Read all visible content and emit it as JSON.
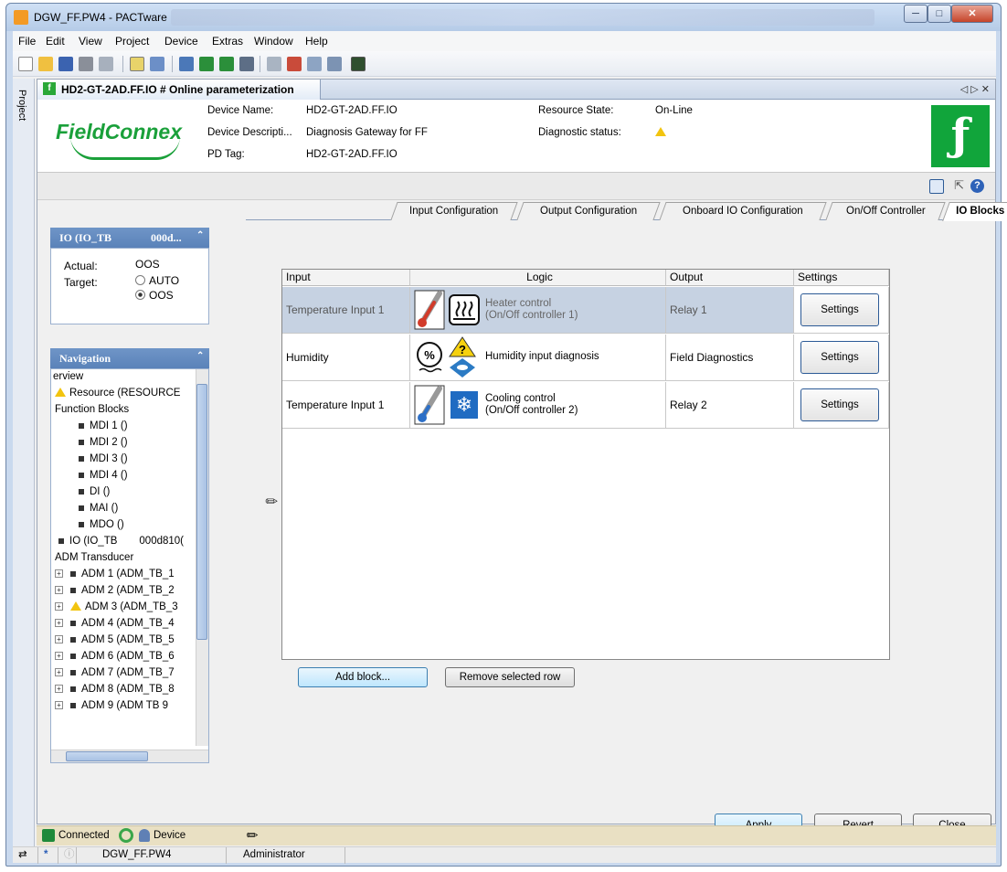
{
  "window": {
    "title": "DGW_FF.PW4 - PACTware"
  },
  "menu": [
    "File",
    "Edit",
    "View",
    "Project",
    "Device",
    "Extras",
    "Window",
    "Help"
  ],
  "project_tab": {
    "label": "Project"
  },
  "doc_tab": {
    "title": "HD2-GT-2AD.FF.IO # Online parameterization",
    "controls": "◁ ▷ ✕"
  },
  "header": {
    "logo": "FieldConnex",
    "device_name_label": "Device Name:",
    "device_name": "HD2-GT-2AD.FF.IO",
    "device_desc_label": "Device Descripti...",
    "device_desc": "Diagnosis Gateway for FF",
    "pd_tag_label": "PD Tag:",
    "pd_tag": "HD2-GT-2AD.FF.IO",
    "resource_state_label": "Resource State:",
    "resource_state": "On-Line",
    "diag_status_label": "Diagnostic status:"
  },
  "io_panel": {
    "title": "IO (IO_TB",
    "title_right": "000d...",
    "actual_label": "Actual:",
    "actual_value": "OOS",
    "target_label": "Target:",
    "target_options": [
      "AUTO",
      "OOS"
    ],
    "target_selected": "OOS"
  },
  "nav_panel": {
    "title": "Navigation",
    "items": [
      "erview",
      "Resource (RESOURCE",
      "Function Blocks",
      "MDI 1 ()",
      "MDI 2 ()",
      "MDI 3 ()",
      "MDI 4 ()",
      "DI ()",
      "MAI ()",
      "MDO ()",
      "IO (IO_TB",
      "000d810(",
      "ADM Transducer",
      "ADM 1 (ADM_TB_1",
      "ADM 2 (ADM_TB_2",
      "ADM 3 (ADM_TB_3",
      "ADM 4 (ADM_TB_4",
      "ADM 5 (ADM_TB_5",
      "ADM 6 (ADM_TB_6",
      "ADM 7 (ADM_TB_7",
      "ADM 8 (ADM_TB_8",
      "ADM 9 (ADM TB 9"
    ]
  },
  "tabs": [
    "Input Configuration",
    "Output Configuration",
    "Onboard IO Configuration",
    "On/Off Controller",
    "IO Blocks"
  ],
  "grid": {
    "headers": [
      "Input",
      "Logic",
      "Output",
      "Settings"
    ],
    "rows": [
      {
        "input": "Temperature Input 1",
        "logic": "Heater control",
        "logic_sub": "(On/Off controller 1)",
        "output": "Relay 1",
        "settings": "Settings"
      },
      {
        "input": "Humidity",
        "logic": "Humidity input diagnosis",
        "logic_sub": "",
        "output": "Field Diagnostics",
        "settings": "Settings"
      },
      {
        "input": "Temperature Input 1",
        "logic": "Cooling control",
        "logic_sub": "(On/Off controller 2)",
        "output": "Relay 2",
        "settings": "Settings"
      }
    ]
  },
  "buttons": {
    "add_block": "Add block...",
    "remove_row": "Remove selected row",
    "apply": "Apply",
    "revert": "Revert",
    "close": "Close"
  },
  "connection_bar": {
    "connected": "Connected",
    "device": "Device"
  },
  "status_bar": {
    "project_file": "DGW_FF.PW4",
    "user": "Administrator"
  },
  "colors": {
    "brand_green": "#1aa03a",
    "selected_row": "#c6d2e2",
    "panel_header": "#5a82b9"
  }
}
